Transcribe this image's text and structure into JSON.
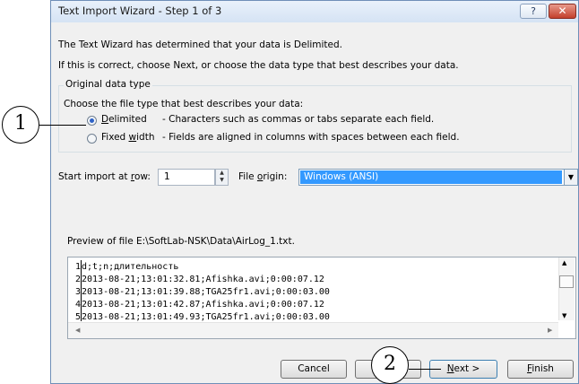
{
  "dialog": {
    "title": "Text Import Wizard - Step 1 of 3",
    "help_label": "?",
    "close_label": "✕",
    "intro_line1": "The Text Wizard has determined that your data is Delimited.",
    "intro_line2": "If this is correct, choose Next, or choose the data type that best describes your data."
  },
  "original_data_type": {
    "group_label": "Original data type",
    "prompt": "Choose the file type that best describes your data:",
    "options": [
      {
        "label_u": "D",
        "label_rest": "elimited",
        "description": "- Characters such as commas or tabs separate each field.",
        "selected": true
      },
      {
        "label_pre": "Fixed ",
        "label_u": "w",
        "label_rest": "idth",
        "description": "- Fields are aligned in columns with spaces between each field.",
        "selected": false
      }
    ]
  },
  "import_settings": {
    "start_row_pre": "Start import at ",
    "start_row_u": "r",
    "start_row_post": "ow:",
    "start_row_value": "1",
    "file_origin_pre": "File ",
    "file_origin_u": "o",
    "file_origin_post": "rigin:",
    "file_origin_value": "Windows (ANSI)"
  },
  "preview": {
    "label": "Preview of file E:\\SoftLab-NSK\\Data\\AirLog_1.txt.",
    "rows": [
      {
        "num": "1",
        "text": "d;t;n;длительность"
      },
      {
        "num": "2",
        "text": "2013-08-21;13:01:32.81;Afishka.avi;0:00:07.12"
      },
      {
        "num": "3",
        "text": "2013-08-21;13:01:39.88;TGA25fr1.avi;0:00:03.00"
      },
      {
        "num": "4",
        "text": "2013-08-21;13:01:42.87;Afishka.avi;0:00:07.12"
      },
      {
        "num": "5",
        "text": "2013-08-21;13:01:49.93;TGA25fr1.avi;0:00:03.00"
      }
    ]
  },
  "buttons": {
    "cancel": "Cancel",
    "back": "",
    "next_u": "N",
    "next_rest": "ext >",
    "finish_u": "F",
    "finish_rest": "inish"
  },
  "callouts": {
    "one": "1",
    "two": "2"
  }
}
